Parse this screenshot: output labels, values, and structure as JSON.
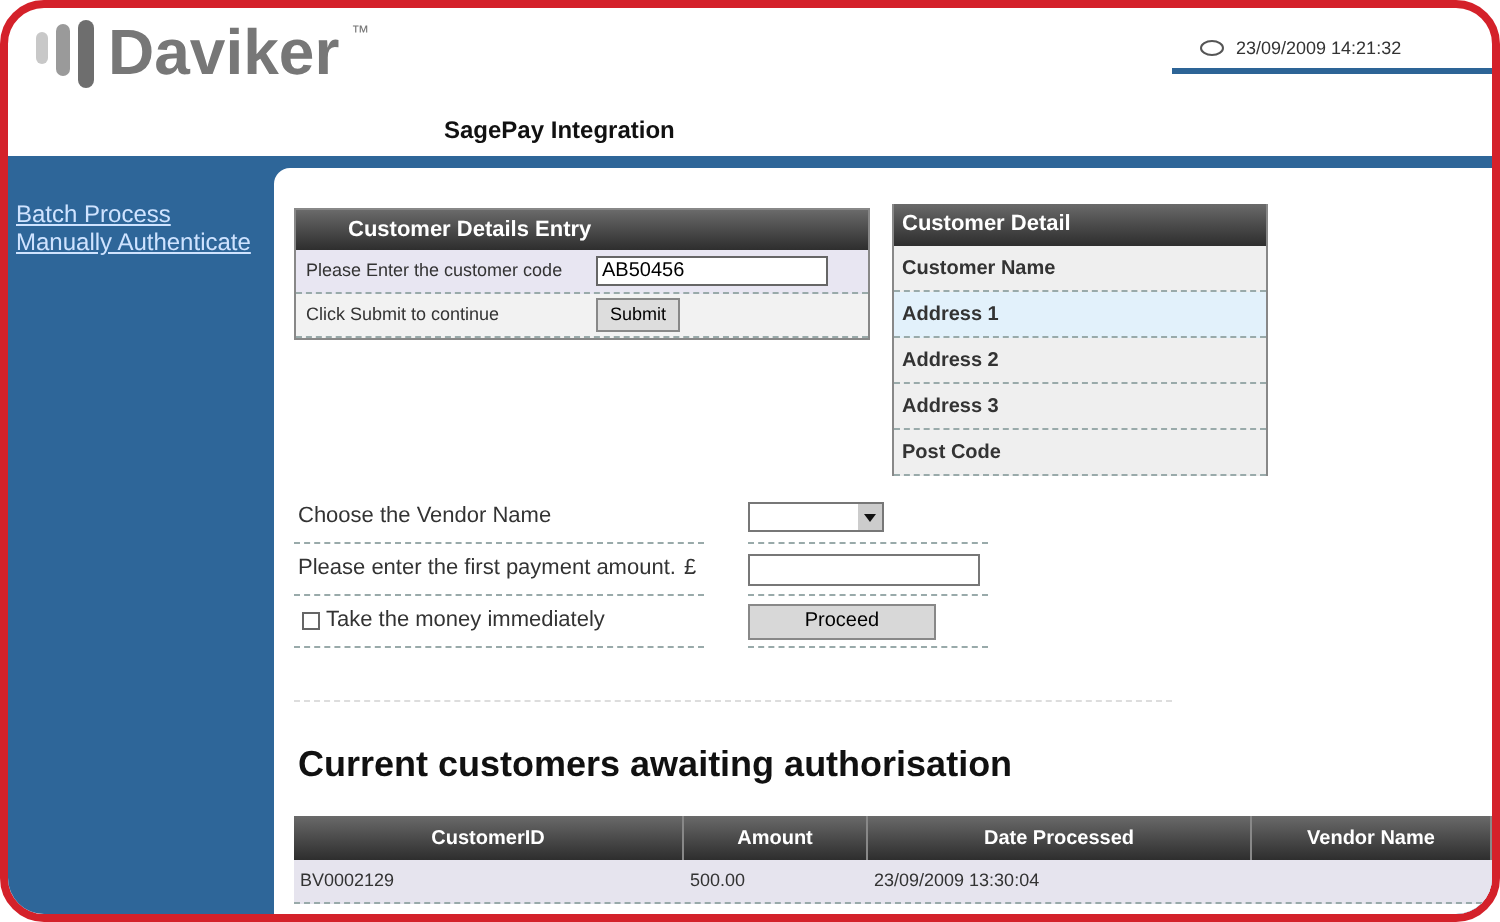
{
  "header": {
    "logo": "Daviker",
    "trademark": "™",
    "datetime": "23/09/2009 14:21:32",
    "page_title": "SagePay Integration"
  },
  "sidebar": {
    "links": [
      "Batch Process",
      "Manually Authenticate"
    ]
  },
  "customer_entry": {
    "title": "Customer Details Entry",
    "code_label": "Please Enter the customer code",
    "code_value": "AB50456",
    "submit_label": "Click Submit to continue",
    "submit_button": "Submit"
  },
  "customer_detail": {
    "title": "Customer Detail",
    "fields": [
      "Customer Name",
      "Address 1",
      "Address 2",
      "Address 3",
      "Post Code"
    ]
  },
  "payment_form": {
    "vendor_label": "Choose the Vendor Name",
    "amount_label": "Please enter the first payment amount.",
    "currency": "£",
    "take_money": {
      "label": "Take the money immediately",
      "checked": false
    },
    "proceed_button": "Proceed"
  },
  "awaiting": {
    "heading": "Current customers awaiting authorisation",
    "columns": [
      "CustomerID",
      "Amount",
      "Date Processed",
      "Vendor Name"
    ],
    "rows": [
      [
        "BV0002129",
        "500.00",
        "23/09/2009 13:30:04",
        ""
      ]
    ]
  }
}
